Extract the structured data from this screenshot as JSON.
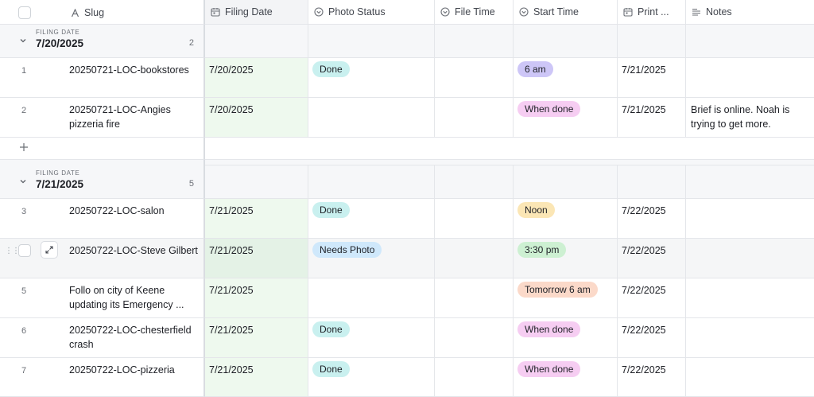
{
  "columns": {
    "slug": "Slug",
    "filing_date": "Filing Date",
    "photo_status": "Photo Status",
    "file_time": "File Time",
    "start_time": "Start Time",
    "print": "Print ...",
    "notes": "Notes"
  },
  "groups": [
    {
      "label": "FILING DATE",
      "title": "7/20/2025",
      "count": "2",
      "rows": [
        {
          "num": "1",
          "slug": "20250721-LOC-bookstores",
          "filing_date": "7/20/2025",
          "photo_status": "Done",
          "file_time": "",
          "start_time": "6 am",
          "print": "7/21/2025",
          "notes": ""
        },
        {
          "num": "2",
          "slug": "20250721-LOC-Angies pizzeria fire",
          "filing_date": "7/20/2025",
          "photo_status": "",
          "file_time": "",
          "start_time": "When done",
          "print": "7/21/2025",
          "notes": "Brief is online. Noah is trying to get more."
        }
      ]
    },
    {
      "label": "FILING DATE",
      "title": "7/21/2025",
      "count": "5",
      "rows": [
        {
          "num": "3",
          "slug": "20250722-LOC-salon",
          "filing_date": "7/21/2025",
          "photo_status": "Done",
          "file_time": "",
          "start_time": "Noon",
          "print": "7/22/2025",
          "notes": ""
        },
        {
          "num": "",
          "slug": "20250722-LOC-Steve Gilbert",
          "filing_date": "7/21/2025",
          "photo_status": "Needs Photo",
          "file_time": "",
          "start_time": "3:30 pm",
          "print": "7/22/2025",
          "notes": ""
        },
        {
          "num": "5",
          "slug": "Follo on city of Keene updating its Emergency ...",
          "filing_date": "7/21/2025",
          "photo_status": "",
          "file_time": "",
          "start_time": "Tomorrow 6 am",
          "print": "7/22/2025",
          "notes": ""
        },
        {
          "num": "6",
          "slug": "20250722-LOC-chesterfield crash",
          "filing_date": "7/21/2025",
          "photo_status": "Done",
          "file_time": "",
          "start_time": "When done",
          "print": "7/22/2025",
          "notes": ""
        },
        {
          "num": "7",
          "slug": "20250722-LOC-pizzeria",
          "filing_date": "7/21/2025",
          "photo_status": "Done",
          "file_time": "",
          "start_time": "When done",
          "print": "7/22/2025",
          "notes": ""
        }
      ]
    }
  ],
  "colors": {
    "Done": "#c9f0ef",
    "Needs Photo": "#cfe8fb",
    "6 am": "#cdc6f7",
    "When done": "#f6cdf2",
    "Noon": "#fbe6b5",
    "3:30 pm": "#cdf0d2",
    "Tomorrow 6 am": "#fbd9c9"
  },
  "icons": {
    "slug": "text-a-icon",
    "filing_date": "calendar-icon",
    "photo_status": "status-circle-icon",
    "file_time": "clock-circle-icon",
    "start_time": "clock-circle-icon",
    "print": "calendar-icon",
    "notes": "long-text-icon"
  }
}
